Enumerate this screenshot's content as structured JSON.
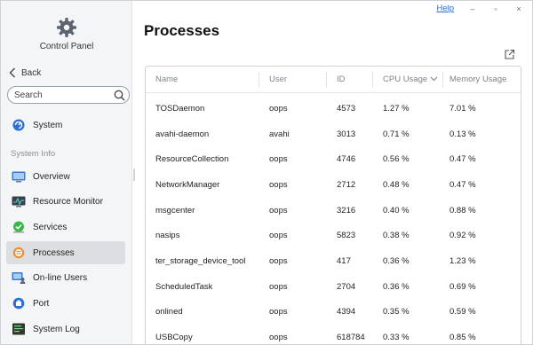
{
  "app": {
    "title": "Control Panel"
  },
  "topbar": {
    "help": "Help",
    "minimize": "–",
    "maximize": "▫",
    "close": "×"
  },
  "sidebar": {
    "back": "Back",
    "search_placeholder": "Search",
    "section": "System Info",
    "items": [
      {
        "label": "System",
        "icon": "system-icon"
      },
      {
        "label": "Overview",
        "icon": "overview-icon"
      },
      {
        "label": "Resource Monitor",
        "icon": "resource-monitor-icon"
      },
      {
        "label": "Services",
        "icon": "services-icon"
      },
      {
        "label": "Processes",
        "icon": "processes-icon",
        "active": true
      },
      {
        "label": "On-line Users",
        "icon": "online-users-icon"
      },
      {
        "label": "Port",
        "icon": "port-icon"
      },
      {
        "label": "System Log",
        "icon": "system-log-icon"
      }
    ]
  },
  "main": {
    "title": "Processes"
  },
  "table": {
    "columns": [
      "Name",
      "User",
      "ID",
      "CPU Usage",
      "Memory Usage"
    ],
    "sorted_column": "CPU Usage",
    "rows": [
      [
        "TOSDaemon",
        "oops",
        "4573",
        "1.27 %",
        "7.01 %"
      ],
      [
        "avahi-daemon",
        "avahi",
        "3013",
        "0.71 %",
        "0.13 %"
      ],
      [
        "ResourceCollection",
        "oops",
        "4746",
        "0.56 %",
        "0.47 %"
      ],
      [
        "NetworkManager",
        "oops",
        "2712",
        "0.48 %",
        "0.47 %"
      ],
      [
        "msgcenter",
        "oops",
        "3216",
        "0.40 %",
        "0.88 %"
      ],
      [
        "nasips",
        "oops",
        "5823",
        "0.38 %",
        "0.92 %"
      ],
      [
        "ter_storage_device_tool",
        "oops",
        "417",
        "0.36 %",
        "1.23 %"
      ],
      [
        "ScheduledTask",
        "oops",
        "2704",
        "0.36 %",
        "0.69 %"
      ],
      [
        "onlined",
        "oops",
        "4394",
        "0.35 %",
        "0.59 %"
      ],
      [
        "USBCopy",
        "oops",
        "618784",
        "0.33 %",
        "0.85 %"
      ]
    ]
  },
  "colors": {
    "accent": "#2a6fd1",
    "active_bg": "#dcdee2",
    "sidebar_bg": "#f4f5f7"
  }
}
